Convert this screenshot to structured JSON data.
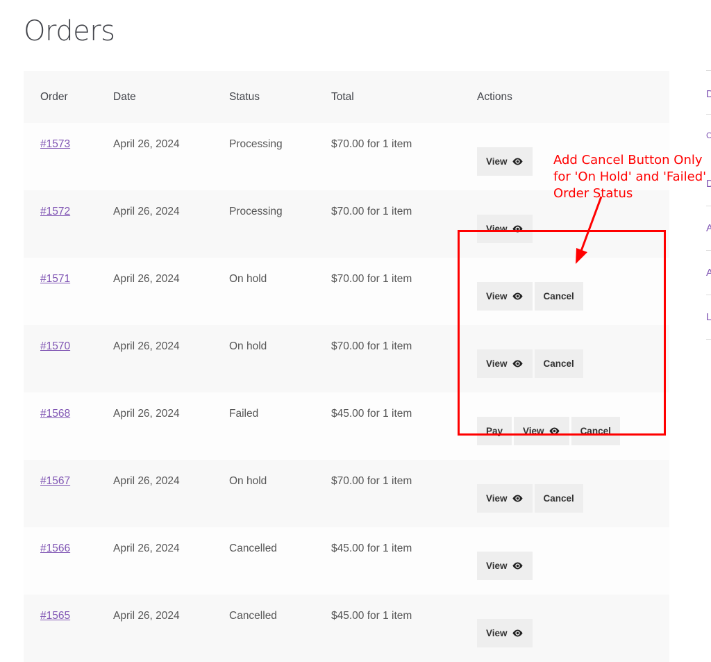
{
  "page_title": "Orders",
  "table": {
    "headers": {
      "order": "Order",
      "date": "Date",
      "status": "Status",
      "total": "Total",
      "actions": "Actions"
    },
    "rows": [
      {
        "order": "#1573",
        "date": "April 26, 2024",
        "status": "Processing",
        "total": "$70.00 for 1 item"
      },
      {
        "order": "#1572",
        "date": "April 26, 2024",
        "status": "Processing",
        "total": "$70.00 for 1 item"
      },
      {
        "order": "#1571",
        "date": "April 26, 2024",
        "status": "On hold",
        "total": "$70.00 for 1 item"
      },
      {
        "order": "#1570",
        "date": "April 26, 2024",
        "status": "On hold",
        "total": "$70.00 for 1 item"
      },
      {
        "order": "#1568",
        "date": "April 26, 2024",
        "status": "Failed",
        "total": "$45.00 for 1 item"
      },
      {
        "order": "#1567",
        "date": "April 26, 2024",
        "status": "On hold",
        "total": "$70.00 for 1 item"
      },
      {
        "order": "#1566",
        "date": "April 26, 2024",
        "status": "Cancelled",
        "total": "$45.00 for 1 item"
      },
      {
        "order": "#1565",
        "date": "April 26, 2024",
        "status": "Cancelled",
        "total": "$45.00 for 1 item"
      }
    ]
  },
  "buttons": {
    "view": "View",
    "cancel": "Cancel",
    "pay": "Pay"
  },
  "annotation": {
    "line1": "Add Cancel Button Only",
    "line2": "for 'On Hold' and 'Failed'",
    "line3": "Order Status"
  },
  "sidebar_fragments": [
    "D",
    "C",
    "D",
    "A",
    "A",
    "L"
  ],
  "colors": {
    "link": "#7f54b3",
    "annotation": "#ff0000",
    "button_bg": "#eeeeee"
  },
  "icons": {
    "view": "eye-icon"
  }
}
